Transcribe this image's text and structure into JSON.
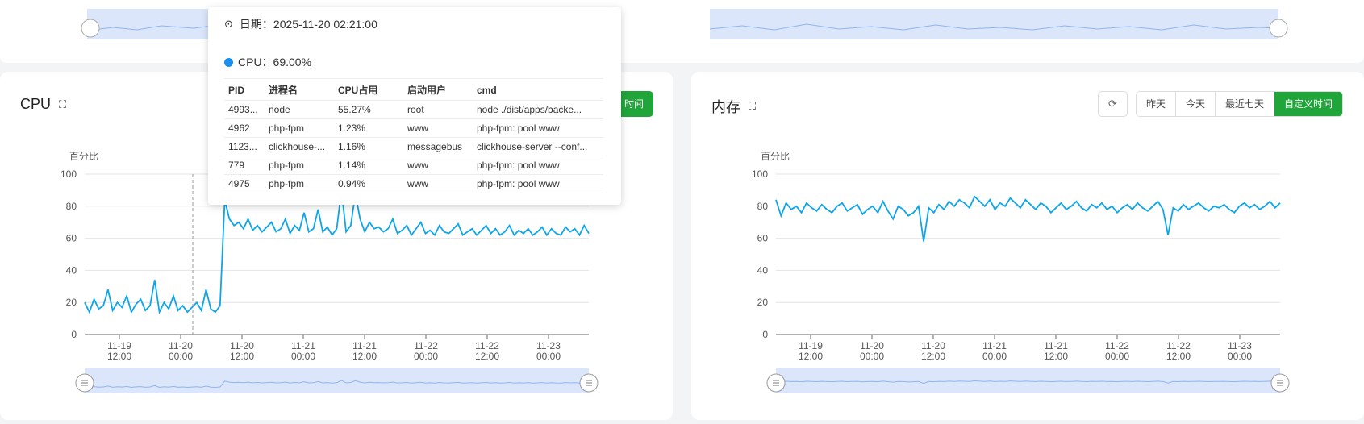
{
  "colors": {
    "accent": "#20a53a",
    "line": "#0ea5e9",
    "slider": "#dbe6fb",
    "sliderLine": "#8eb6f0"
  },
  "cpu_card": {
    "title": "CPU",
    "partial_button": "时间",
    "ylabel": "百分比"
  },
  "mem_card": {
    "title": "内存",
    "ylabel": "百分比",
    "buttons": {
      "yesterday": "昨天",
      "today": "今天",
      "last7": "最近七天",
      "custom": "自定义时间"
    }
  },
  "tooltip": {
    "date": "日期：2025-11-20 02:21:00",
    "cpu": "CPU：69.00%",
    "headers": [
      "PID",
      "进程名",
      "CPU占用",
      "启动用户",
      "cmd"
    ],
    "rows": [
      [
        "4993...",
        "node",
        "55.27%",
        "root",
        "node ./dist/apps/backe..."
      ],
      [
        "4962",
        "php-fpm",
        "1.23%",
        "www",
        "php-fpm: pool www"
      ],
      [
        "1123...",
        "clickhouse-...",
        "1.16%",
        "messagebus",
        "clickhouse-server --conf..."
      ],
      [
        "779",
        "php-fpm",
        "1.14%",
        "www",
        "php-fpm: pool www"
      ],
      [
        "4975",
        "php-fpm",
        "0.94%",
        "www",
        "php-fpm: pool www"
      ]
    ]
  },
  "chart_data": [
    {
      "type": "line",
      "id": "cpu",
      "ylabel": "百分比",
      "ylim": [
        0,
        100
      ],
      "yticks": [
        0,
        20,
        40,
        60,
        80,
        100
      ],
      "xticks": [
        [
          "11-19",
          "12:00"
        ],
        [
          "11-20",
          "00:00"
        ],
        [
          "11-20",
          "12:00"
        ],
        [
          "11-21",
          "00:00"
        ],
        [
          "11-21",
          "12:00"
        ],
        [
          "11-22",
          "00:00"
        ],
        [
          "11-22",
          "12:00"
        ],
        [
          "11-23",
          "00:00"
        ]
      ],
      "series": [
        {
          "values": [
            20,
            14,
            22,
            16,
            18,
            28,
            15,
            20,
            17,
            24,
            14,
            19,
            22,
            15,
            18,
            34,
            14,
            20,
            16,
            24,
            15,
            18,
            14,
            17,
            20,
            15,
            28,
            16,
            14,
            18,
            84,
            72,
            68,
            70,
            66,
            72,
            65,
            68,
            64,
            67,
            70,
            64,
            66,
            72,
            63,
            68,
            65,
            76,
            64,
            66,
            78,
            64,
            67,
            62,
            66,
            90,
            64,
            68,
            88,
            72,
            64,
            70,
            66,
            67,
            64,
            66,
            72,
            63,
            65,
            68,
            62,
            66,
            70,
            63,
            65,
            62,
            68,
            64,
            63,
            66,
            69,
            62,
            64,
            66,
            62,
            65,
            68,
            63,
            66,
            62,
            64,
            68,
            62,
            65,
            63,
            66,
            62,
            64,
            67,
            62,
            66,
            63,
            62,
            67,
            64,
            66,
            62,
            68,
            63
          ]
        }
      ]
    },
    {
      "type": "line",
      "id": "mem",
      "ylabel": "百分比",
      "ylim": [
        0,
        100
      ],
      "yticks": [
        0,
        20,
        40,
        60,
        80,
        100
      ],
      "xticks": [
        [
          "11-19",
          "12:00"
        ],
        [
          "11-20",
          "00:00"
        ],
        [
          "11-20",
          "12:00"
        ],
        [
          "11-21",
          "00:00"
        ],
        [
          "11-21",
          "12:00"
        ],
        [
          "11-22",
          "00:00"
        ],
        [
          "11-22",
          "12:00"
        ],
        [
          "11-23",
          "00:00"
        ]
      ],
      "series": [
        {
          "values": [
            84,
            74,
            82,
            78,
            80,
            76,
            82,
            79,
            77,
            81,
            78,
            76,
            80,
            82,
            77,
            79,
            81,
            75,
            78,
            80,
            76,
            83,
            77,
            72,
            80,
            78,
            74,
            76,
            80,
            58,
            79,
            76,
            81,
            78,
            83,
            80,
            84,
            82,
            79,
            86,
            83,
            80,
            84,
            78,
            82,
            80,
            85,
            82,
            79,
            84,
            81,
            78,
            82,
            80,
            76,
            79,
            82,
            78,
            80,
            83,
            79,
            77,
            81,
            79,
            82,
            78,
            80,
            76,
            79,
            81,
            78,
            82,
            79,
            77,
            80,
            83,
            78,
            62,
            79,
            77,
            81,
            78,
            80,
            82,
            79,
            77,
            80,
            79,
            81,
            78,
            76,
            80,
            82,
            79,
            81,
            78,
            80,
            83,
            79,
            82
          ]
        }
      ]
    }
  ]
}
